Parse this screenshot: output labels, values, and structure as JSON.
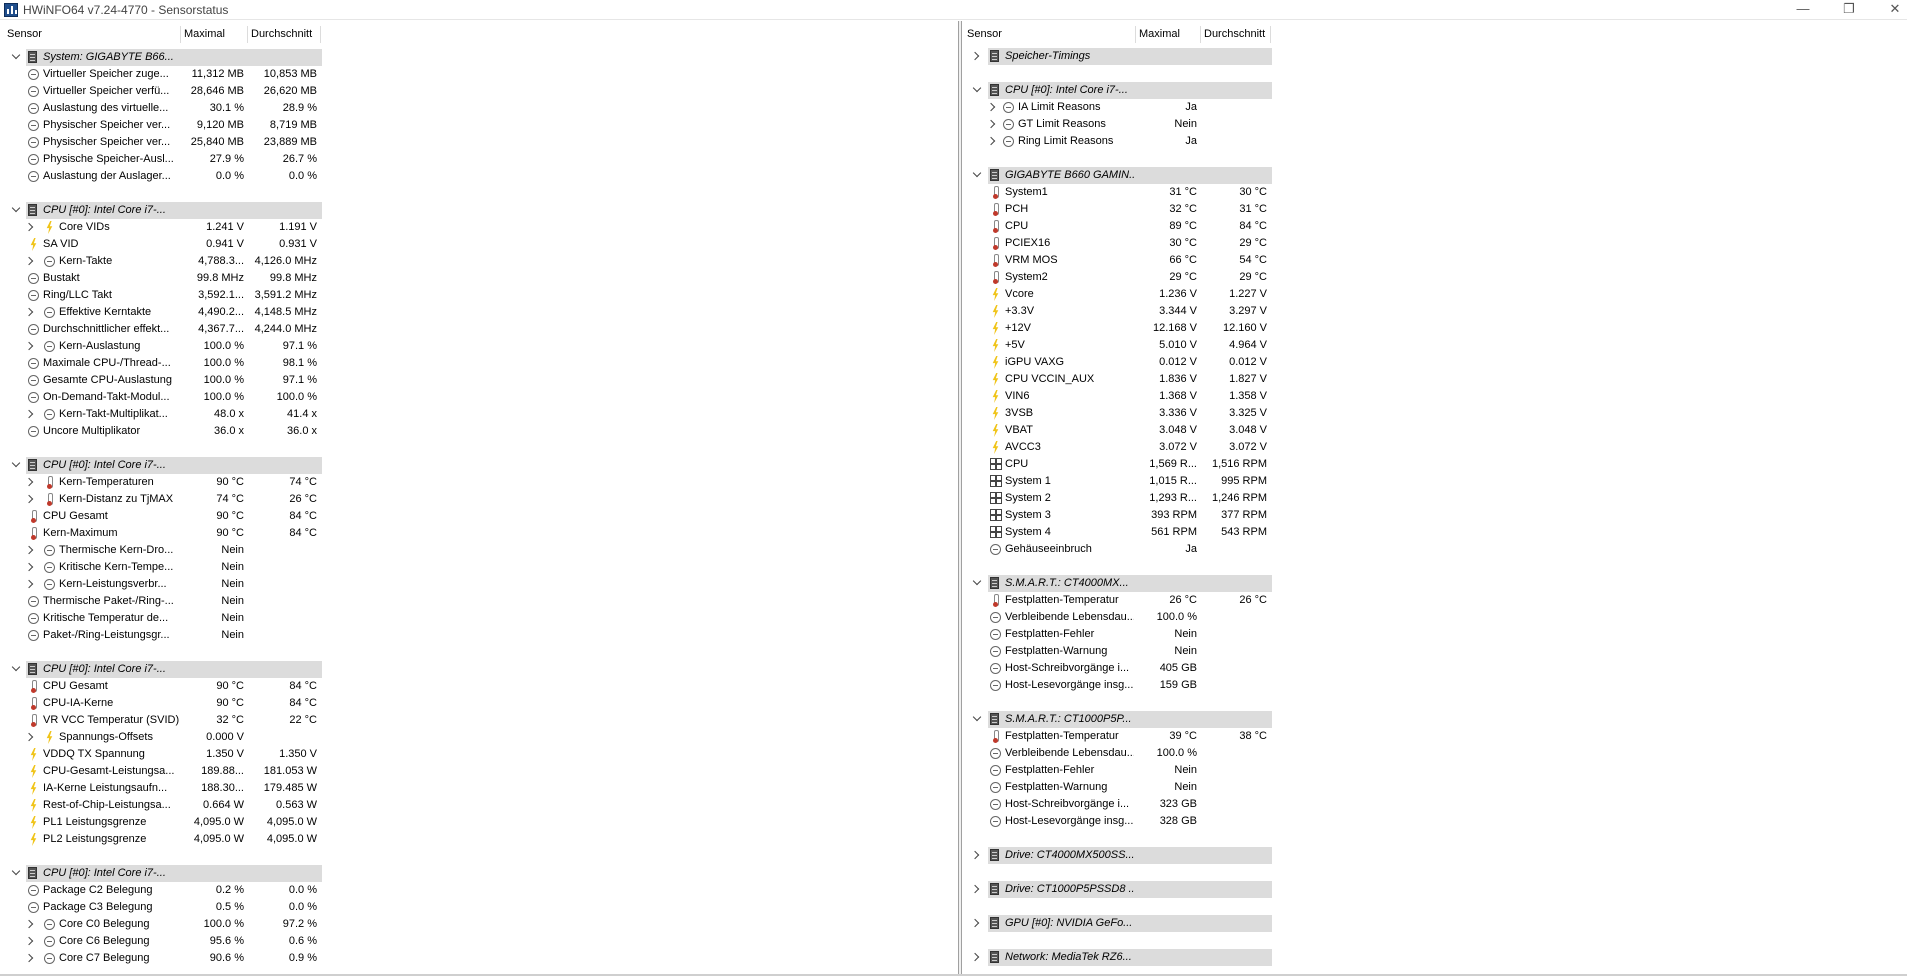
{
  "window": {
    "title": "HWiNFO64 v7.24-4770 - Sensorstatus",
    "minimize": "—",
    "maximize": "❐",
    "close": "✕"
  },
  "columns": {
    "sensor": "Sensor",
    "max": "Maximal",
    "avg": "Durchschnitt"
  },
  "left": [
    {
      "t": "g",
      "e": "open",
      "l": "System: GIGABYTE B66..."
    },
    {
      "t": "r",
      "i": "round",
      "l": "Virtueller Speicher zuge...",
      "m": "11,312 MB",
      "a": "10,853 MB"
    },
    {
      "t": "r",
      "i": "round",
      "l": "Virtueller Speicher verfü...",
      "m": "28,646 MB",
      "a": "26,620 MB"
    },
    {
      "t": "r",
      "i": "round",
      "l": "Auslastung des virtuelle...",
      "m": "30.1 %",
      "a": "28.9 %"
    },
    {
      "t": "r",
      "i": "round",
      "l": "Physischer Speicher ver...",
      "m": "9,120 MB",
      "a": "8,719 MB"
    },
    {
      "t": "r",
      "i": "round",
      "l": "Physischer Speicher ver...",
      "m": "25,840 MB",
      "a": "23,889 MB"
    },
    {
      "t": "r",
      "i": "round",
      "l": "Physische Speicher-Ausl...",
      "m": "27.9 %",
      "a": "26.7 %"
    },
    {
      "t": "r",
      "i": "round",
      "l": "Auslastung der Auslager...",
      "m": "0.0 %",
      "a": "0.0 %"
    },
    {
      "t": "s"
    },
    {
      "t": "g",
      "e": "open",
      "l": "CPU [#0]: Intel Core i7-..."
    },
    {
      "t": "r",
      "e": "closed",
      "i": "bolt",
      "l": "Core VIDs",
      "m": "1.241 V",
      "a": "1.191 V"
    },
    {
      "t": "r",
      "i": "bolt",
      "l": "SA VID",
      "m": "0.941 V",
      "a": "0.931 V"
    },
    {
      "t": "r",
      "e": "closed",
      "i": "round",
      "l": "Kern-Takte",
      "m": "4,788.3...",
      "a": "4,126.0 MHz"
    },
    {
      "t": "r",
      "i": "round",
      "l": "Bustakt",
      "m": "99.8 MHz",
      "a": "99.8 MHz"
    },
    {
      "t": "r",
      "i": "round",
      "l": "Ring/LLC Takt",
      "m": "3,592.1...",
      "a": "3,591.2 MHz"
    },
    {
      "t": "r",
      "e": "closed",
      "i": "round",
      "l": "Effektive Kerntakte",
      "m": "4,490.2...",
      "a": "4,148.5 MHz"
    },
    {
      "t": "r",
      "i": "round",
      "l": "Durchschnittlicher effekt...",
      "m": "4,367.7...",
      "a": "4,244.0 MHz"
    },
    {
      "t": "r",
      "e": "closed",
      "i": "round",
      "l": "Kern-Auslastung",
      "m": "100.0 %",
      "a": "97.1 %"
    },
    {
      "t": "r",
      "i": "round",
      "l": "Maximale CPU-/Thread-...",
      "m": "100.0 %",
      "a": "98.1 %"
    },
    {
      "t": "r",
      "i": "round",
      "l": "Gesamte CPU-Auslastung",
      "m": "100.0 %",
      "a": "97.1 %"
    },
    {
      "t": "r",
      "i": "round",
      "l": "On-Demand-Takt-Modul...",
      "m": "100.0 %",
      "a": "100.0 %"
    },
    {
      "t": "r",
      "e": "closed",
      "i": "round",
      "l": "Kern-Takt-Multiplikat...",
      "m": "48.0 x",
      "a": "41.4 x"
    },
    {
      "t": "r",
      "i": "round",
      "l": "Uncore Multiplikator",
      "m": "36.0 x",
      "a": "36.0 x"
    },
    {
      "t": "s"
    },
    {
      "t": "g",
      "e": "open",
      "l": "CPU [#0]: Intel Core i7-..."
    },
    {
      "t": "r",
      "e": "closed",
      "i": "thermo",
      "l": "Kern-Temperaturen",
      "m": "90 °C",
      "a": "74 °C"
    },
    {
      "t": "r",
      "e": "closed",
      "i": "thermo",
      "l": "Kern-Distanz zu TjMAX",
      "m": "74 °C",
      "a": "26 °C"
    },
    {
      "t": "r",
      "i": "thermo",
      "l": "CPU Gesamt",
      "m": "90 °C",
      "a": "84 °C"
    },
    {
      "t": "r",
      "i": "thermo",
      "l": "Kern-Maximum",
      "m": "90 °C",
      "a": "84 °C"
    },
    {
      "t": "r",
      "e": "closed",
      "i": "round",
      "l": "Thermische Kern-Dro...",
      "m": "Nein",
      "a": ""
    },
    {
      "t": "r",
      "e": "closed",
      "i": "round",
      "l": "Kritische Kern-Tempe...",
      "m": "Nein",
      "a": ""
    },
    {
      "t": "r",
      "e": "closed",
      "i": "round",
      "l": "Kern-Leistungsverbr...",
      "m": "Nein",
      "a": ""
    },
    {
      "t": "r",
      "i": "round",
      "l": "Thermische Paket-/Ring-...",
      "m": "Nein",
      "a": ""
    },
    {
      "t": "r",
      "i": "round",
      "l": "Kritische Temperatur de...",
      "m": "Nein",
      "a": ""
    },
    {
      "t": "r",
      "i": "round",
      "l": "Paket-/Ring-Leistungsgr...",
      "m": "Nein",
      "a": ""
    },
    {
      "t": "s"
    },
    {
      "t": "g",
      "e": "open",
      "l": "CPU [#0]: Intel Core i7-..."
    },
    {
      "t": "r",
      "i": "thermo",
      "l": "CPU Gesamt",
      "m": "90 °C",
      "a": "84 °C"
    },
    {
      "t": "r",
      "i": "thermo",
      "l": "CPU-IA-Kerne",
      "m": "90 °C",
      "a": "84 °C"
    },
    {
      "t": "r",
      "i": "thermo",
      "l": "VR VCC Temperatur (SVID)",
      "m": "32 °C",
      "a": "22 °C"
    },
    {
      "t": "r",
      "e": "closed",
      "i": "bolt",
      "l": "Spannungs-Offsets",
      "m": "0.000 V",
      "a": ""
    },
    {
      "t": "r",
      "i": "bolt",
      "l": "VDDQ TX Spannung",
      "m": "1.350 V",
      "a": "1.350 V"
    },
    {
      "t": "r",
      "i": "bolt",
      "l": "CPU-Gesamt-Leistungsa...",
      "m": "189.88...",
      "a": "181.053 W"
    },
    {
      "t": "r",
      "i": "bolt",
      "l": "IA-Kerne Leistungsaufn...",
      "m": "188.30...",
      "a": "179.485 W"
    },
    {
      "t": "r",
      "i": "bolt",
      "l": "Rest-of-Chip-Leistungsa...",
      "m": "0.664 W",
      "a": "0.563 W"
    },
    {
      "t": "r",
      "i": "bolt",
      "l": "PL1 Leistungsgrenze",
      "m": "4,095.0 W",
      "a": "4,095.0 W"
    },
    {
      "t": "r",
      "i": "bolt",
      "l": "PL2 Leistungsgrenze",
      "m": "4,095.0 W",
      "a": "4,095.0 W"
    },
    {
      "t": "s"
    },
    {
      "t": "g",
      "e": "open",
      "l": "CPU [#0]: Intel Core i7-..."
    },
    {
      "t": "r",
      "i": "round",
      "l": "Package C2 Belegung",
      "m": "0.2 %",
      "a": "0.0 %"
    },
    {
      "t": "r",
      "i": "round",
      "l": "Package C3 Belegung",
      "m": "0.5 %",
      "a": "0.0 %"
    },
    {
      "t": "r",
      "e": "closed",
      "i": "round",
      "l": "Core C0 Belegung",
      "m": "100.0 %",
      "a": "97.2 %"
    },
    {
      "t": "r",
      "e": "closed",
      "i": "round",
      "l": "Core C6 Belegung",
      "m": "95.6 %",
      "a": "0.6 %"
    },
    {
      "t": "r",
      "e": "closed",
      "i": "round",
      "l": "Core C7 Belegung",
      "m": "90.6 %",
      "a": "0.9 %"
    }
  ],
  "right": [
    {
      "t": "g",
      "e": "closed",
      "l": "Speicher-Timings"
    },
    {
      "t": "s"
    },
    {
      "t": "g",
      "e": "open",
      "l": "CPU [#0]: Intel Core i7-..."
    },
    {
      "t": "r",
      "e": "closed",
      "i": "round",
      "l": "IA Limit Reasons",
      "m": "Ja",
      "a": ""
    },
    {
      "t": "r",
      "e": "closed",
      "i": "round",
      "l": "GT Limit Reasons",
      "m": "Nein",
      "a": ""
    },
    {
      "t": "r",
      "e": "closed",
      "i": "round",
      "l": "Ring Limit Reasons",
      "m": "Ja",
      "a": ""
    },
    {
      "t": "s"
    },
    {
      "t": "g",
      "e": "open",
      "l": "GIGABYTE B660 GAMIN..."
    },
    {
      "t": "r",
      "i": "thermo",
      "l": "System1",
      "m": "31 °C",
      "a": "30 °C"
    },
    {
      "t": "r",
      "i": "thermo",
      "l": "PCH",
      "m": "32 °C",
      "a": "31 °C"
    },
    {
      "t": "r",
      "i": "thermo",
      "l": "CPU",
      "m": "89 °C",
      "a": "84 °C"
    },
    {
      "t": "r",
      "i": "thermo",
      "l": "PCIEX16",
      "m": "30 °C",
      "a": "29 °C"
    },
    {
      "t": "r",
      "i": "thermo",
      "l": "VRM MOS",
      "m": "66 °C",
      "a": "54 °C"
    },
    {
      "t": "r",
      "i": "thermo",
      "l": "System2",
      "m": "29 °C",
      "a": "29 °C"
    },
    {
      "t": "r",
      "i": "bolt",
      "l": "Vcore",
      "m": "1.236 V",
      "a": "1.227 V"
    },
    {
      "t": "r",
      "i": "bolt",
      "l": "+3.3V",
      "m": "3.344 V",
      "a": "3.297 V"
    },
    {
      "t": "r",
      "i": "bolt",
      "l": "+12V",
      "m": "12.168 V",
      "a": "12.160 V"
    },
    {
      "t": "r",
      "i": "bolt",
      "l": "+5V",
      "m": "5.010 V",
      "a": "4.964 V"
    },
    {
      "t": "r",
      "i": "bolt",
      "l": "iGPU VAXG",
      "m": "0.012 V",
      "a": "0.012 V"
    },
    {
      "t": "r",
      "i": "bolt",
      "l": "CPU VCCIN_AUX",
      "m": "1.836 V",
      "a": "1.827 V"
    },
    {
      "t": "r",
      "i": "bolt",
      "l": "VIN6",
      "m": "1.368 V",
      "a": "1.358 V"
    },
    {
      "t": "r",
      "i": "bolt",
      "l": "3VSB",
      "m": "3.336 V",
      "a": "3.325 V"
    },
    {
      "t": "r",
      "i": "bolt",
      "l": "VBAT",
      "m": "3.048 V",
      "a": "3.048 V"
    },
    {
      "t": "r",
      "i": "bolt",
      "l": "AVCC3",
      "m": "3.072 V",
      "a": "3.072 V"
    },
    {
      "t": "r",
      "i": "fan",
      "l": "CPU",
      "m": "1,569 R...",
      "a": "1,516 RPM"
    },
    {
      "t": "r",
      "i": "fan",
      "l": "System 1",
      "m": "1,015 R...",
      "a": "995 RPM"
    },
    {
      "t": "r",
      "i": "fan",
      "l": "System 2",
      "m": "1,293 R...",
      "a": "1,246 RPM"
    },
    {
      "t": "r",
      "i": "fan",
      "l": "System 3",
      "m": "393 RPM",
      "a": "377 RPM"
    },
    {
      "t": "r",
      "i": "fan",
      "l": "System 4",
      "m": "561 RPM",
      "a": "543 RPM"
    },
    {
      "t": "r",
      "i": "round",
      "l": "Gehäuseeinbruch",
      "m": "Ja",
      "a": ""
    },
    {
      "t": "s"
    },
    {
      "t": "g",
      "e": "open",
      "l": "S.M.A.R.T.: CT4000MX..."
    },
    {
      "t": "r",
      "i": "thermo",
      "l": "Festplatten-Temperatur",
      "m": "26 °C",
      "a": "26 °C"
    },
    {
      "t": "r",
      "i": "round",
      "l": "Verbleibende Lebensdau...",
      "m": "100.0 %",
      "a": ""
    },
    {
      "t": "r",
      "i": "round",
      "l": "Festplatten-Fehler",
      "m": "Nein",
      "a": ""
    },
    {
      "t": "r",
      "i": "round",
      "l": "Festplatten-Warnung",
      "m": "Nein",
      "a": ""
    },
    {
      "t": "r",
      "i": "round",
      "l": "Host-Schreibvorgänge i...",
      "m": "405 GB",
      "a": ""
    },
    {
      "t": "r",
      "i": "round",
      "l": "Host-Lesevorgänge insg...",
      "m": "159 GB",
      "a": ""
    },
    {
      "t": "s"
    },
    {
      "t": "g",
      "e": "open",
      "l": "S.M.A.R.T.: CT1000P5P..."
    },
    {
      "t": "r",
      "i": "thermo",
      "l": "Festplatten-Temperatur",
      "m": "39 °C",
      "a": "38 °C"
    },
    {
      "t": "r",
      "i": "round",
      "l": "Verbleibende Lebensdau...",
      "m": "100.0 %",
      "a": ""
    },
    {
      "t": "r",
      "i": "round",
      "l": "Festplatten-Fehler",
      "m": "Nein",
      "a": ""
    },
    {
      "t": "r",
      "i": "round",
      "l": "Festplatten-Warnung",
      "m": "Nein",
      "a": ""
    },
    {
      "t": "r",
      "i": "round",
      "l": "Host-Schreibvorgänge i...",
      "m": "323 GB",
      "a": ""
    },
    {
      "t": "r",
      "i": "round",
      "l": "Host-Lesevorgänge insg...",
      "m": "328 GB",
      "a": ""
    },
    {
      "t": "s"
    },
    {
      "t": "g",
      "e": "closed",
      "l": "Drive: CT4000MX500SS..."
    },
    {
      "t": "s"
    },
    {
      "t": "g",
      "e": "closed",
      "l": "Drive: CT1000P5PSSD8 ..."
    },
    {
      "t": "s"
    },
    {
      "t": "g",
      "e": "closed",
      "l": "GPU [#0]: NVIDIA GeFo..."
    },
    {
      "t": "s"
    },
    {
      "t": "g",
      "e": "closed",
      "l": "Network: MediaTek RZ6..."
    }
  ]
}
